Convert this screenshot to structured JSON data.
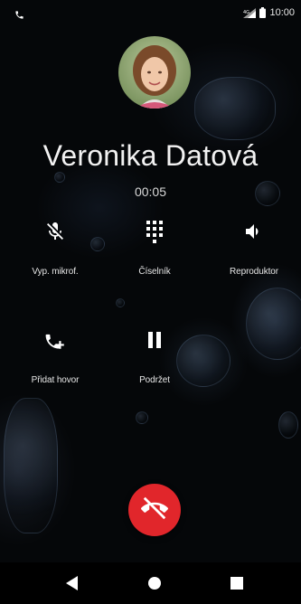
{
  "status_bar": {
    "time": "10:00",
    "icons": [
      "phone-call-icon",
      "signal-icon",
      "battery-icon"
    ]
  },
  "contact": {
    "name": "Veronika Datová",
    "avatar_icon": "contact-photo",
    "timer": "00:05"
  },
  "controls": [
    {
      "label": "Vyp. mikrof.",
      "icon": "mic-off-icon"
    },
    {
      "label": "Číselník",
      "icon": "dialpad-icon"
    },
    {
      "label": "Reproduktor",
      "icon": "speaker-icon"
    },
    {
      "label": "Přidat hovor",
      "icon": "add-call-icon"
    },
    {
      "label": "Podržet",
      "icon": "pause-icon"
    }
  ],
  "end_call": {
    "icon": "end-call-icon",
    "color": "#e1262b"
  },
  "nav": {
    "icons": [
      "back-icon",
      "home-icon",
      "recents-icon"
    ]
  }
}
